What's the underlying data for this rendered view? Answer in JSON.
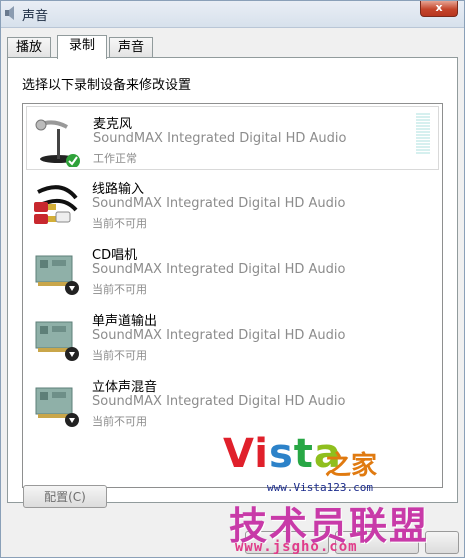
{
  "window": {
    "title": "声音",
    "close_label": "x"
  },
  "tabs": [
    {
      "label": "播放"
    },
    {
      "label": "录制"
    },
    {
      "label": "声音"
    }
  ],
  "recording": {
    "instruction": "选择以下录制设备来修改设置",
    "devices": [
      {
        "name": "麦克风",
        "driver": "SoundMAX Integrated Digital HD Audio",
        "status": "工作正常",
        "icon": "microphone-icon",
        "selected": true
      },
      {
        "name": "线路输入",
        "driver": "SoundMAX Integrated Digital HD Audio",
        "status": "当前不可用",
        "icon": "line-in-cable-icon"
      },
      {
        "name": "CD唱机",
        "driver": "SoundMAX Integrated Digital HD Audio",
        "status": "当前不可用",
        "icon": "sound-card-icon"
      },
      {
        "name": "单声道输出",
        "driver": "SoundMAX Integrated Digital HD Audio",
        "status": "当前不可用",
        "icon": "sound-card-icon"
      },
      {
        "name": "立体声混音",
        "driver": "SoundMAX Integrated Digital HD Audio",
        "status": "当前不可用",
        "icon": "sound-card-icon"
      }
    ]
  },
  "buttons": {
    "configure": "配置(C)"
  },
  "watermark": {
    "logo_v": "V",
    "logo_i": "i",
    "logo_s": "s",
    "logo_t": "t",
    "logo_a": "a",
    "logo_suffix": "之家",
    "url1": "www.Vista123.com",
    "slogan": "技术员联盟",
    "url2": "www.jsgho.com"
  },
  "colors": {
    "selected_border": "#d9d9d9",
    "status_ok_check": "#2fa23a",
    "disabled_text": "#8c8c8c"
  }
}
